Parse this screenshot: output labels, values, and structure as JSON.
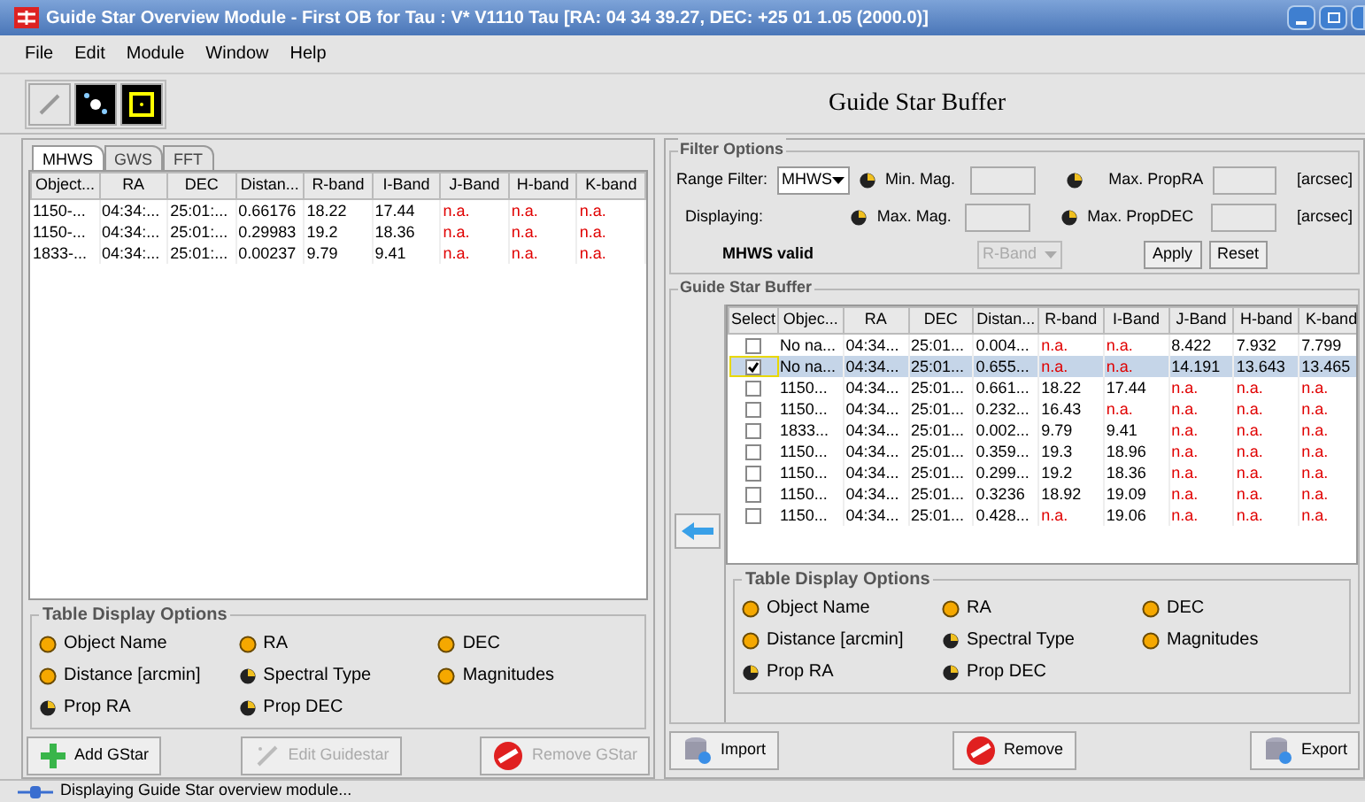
{
  "window": {
    "title": "Guide Star Overview Module - First OB for Tau : V* V1110 Tau [RA: 04 34 39.27, DEC: +25 01 1.05 (2000.0)]"
  },
  "menu": [
    "File",
    "Edit",
    "Module",
    "Window",
    "Help"
  ],
  "heading": "Guide Star Buffer",
  "left": {
    "tabs": [
      {
        "label": "MHWS",
        "selected": true
      },
      {
        "label": "GWS",
        "selected": false
      },
      {
        "label": "FFT",
        "selected": false
      }
    ],
    "columns": [
      "Object...",
      "RA",
      "DEC",
      "Distan...",
      "R-band",
      "I-Band",
      "J-Band",
      "H-band",
      "K-band"
    ],
    "rows": [
      [
        {
          "text": "1150-...",
          "unavailable": false
        },
        {
          "text": "04:34:...",
          "unavailable": false
        },
        {
          "text": "25:01:...",
          "unavailable": false
        },
        {
          "text": "0.66176",
          "unavailable": false
        },
        {
          "text": "18.22",
          "unavailable": false
        },
        {
          "text": "17.44",
          "unavailable": false
        },
        {
          "text": "n.a.",
          "unavailable": true
        },
        {
          "text": "n.a.",
          "unavailable": true
        },
        {
          "text": "n.a.",
          "unavailable": true
        }
      ],
      [
        {
          "text": "1150-...",
          "unavailable": false
        },
        {
          "text": "04:34:...",
          "unavailable": false
        },
        {
          "text": "25:01:...",
          "unavailable": false
        },
        {
          "text": "0.29983",
          "unavailable": false
        },
        {
          "text": "19.2",
          "unavailable": false
        },
        {
          "text": "18.36",
          "unavailable": false
        },
        {
          "text": "n.a.",
          "unavailable": true
        },
        {
          "text": "n.a.",
          "unavailable": true
        },
        {
          "text": "n.a.",
          "unavailable": true
        }
      ],
      [
        {
          "text": "1833-...",
          "unavailable": false
        },
        {
          "text": "04:34:...",
          "unavailable": false
        },
        {
          "text": "25:01:...",
          "unavailable": false
        },
        {
          "text": "0.00237",
          "unavailable": false
        },
        {
          "text": "9.79",
          "unavailable": false
        },
        {
          "text": "9.41",
          "unavailable": false
        },
        {
          "text": "n.a.",
          "unavailable": true
        },
        {
          "text": "n.a.",
          "unavailable": true
        },
        {
          "text": "n.a.",
          "unavailable": true
        }
      ]
    ],
    "display_options": {
      "title": "Table Display Options",
      "options": [
        {
          "label": "Object Name",
          "on": true
        },
        {
          "label": "RA",
          "on": true
        },
        {
          "label": "DEC",
          "on": true
        },
        {
          "label": "Distance [arcmin]",
          "on": true
        },
        {
          "label": "Spectral Type",
          "on": false
        },
        {
          "label": "Magnitudes",
          "on": true
        },
        {
          "label": "Prop RA",
          "on": false
        },
        {
          "label": "Prop DEC",
          "on": false
        }
      ]
    },
    "buttons": [
      {
        "label": "Add GStar",
        "kind": "add",
        "disabled": false
      },
      {
        "label": "Edit Guidestar",
        "kind": "edit",
        "disabled": true
      },
      {
        "label": "Remove GStar",
        "kind": "remove",
        "disabled": true
      }
    ]
  },
  "filter": {
    "title": "Filter Options",
    "range_label": "Range Filter:",
    "range_value": "MHWS",
    "min_mag": {
      "label": "Min. Mag.",
      "on": false
    },
    "max_prop_ra": {
      "label": "Max. PropRA",
      "on": false
    },
    "unit_1": "[arcsec]",
    "displaying_label": "Displaying:",
    "max_mag": {
      "label": "Max. Mag.",
      "on": false
    },
    "max_prop_dec": {
      "label": "Max. PropDEC",
      "on": false
    },
    "unit_2": "[arcsec]",
    "valid_label": "MHWS valid",
    "band_value": "R-Band",
    "apply": "Apply",
    "reset": "Reset"
  },
  "buffer": {
    "title": "Guide Star Buffer",
    "select_column": "Select",
    "columns": [
      "Objec...",
      "RA",
      "DEC",
      "Distan...",
      "R-band",
      "I-Band",
      "J-Band",
      "H-band",
      "K-band"
    ],
    "rows": [
      {
        "checked": false,
        "selected": false,
        "cells": [
          {
            "text": "No na...",
            "unavailable": false
          },
          {
            "text": "04:34...",
            "unavailable": false
          },
          {
            "text": "25:01...",
            "unavailable": false
          },
          {
            "text": "0.004...",
            "unavailable": false
          },
          {
            "text": "n.a.",
            "unavailable": true
          },
          {
            "text": "n.a.",
            "unavailable": true
          },
          {
            "text": "8.422",
            "unavailable": false
          },
          {
            "text": "7.932",
            "unavailable": false
          },
          {
            "text": "7.799",
            "unavailable": false
          }
        ]
      },
      {
        "checked": true,
        "selected": true,
        "cells": [
          {
            "text": "No na...",
            "unavailable": false
          },
          {
            "text": "04:34...",
            "unavailable": false
          },
          {
            "text": "25:01...",
            "unavailable": false
          },
          {
            "text": "0.655...",
            "unavailable": false
          },
          {
            "text": "n.a.",
            "unavailable": true
          },
          {
            "text": "n.a.",
            "unavailable": true
          },
          {
            "text": "14.191",
            "unavailable": false
          },
          {
            "text": "13.643",
            "unavailable": false
          },
          {
            "text": "13.465",
            "unavailable": false
          }
        ]
      },
      {
        "checked": false,
        "selected": false,
        "cells": [
          {
            "text": "1150...",
            "unavailable": false
          },
          {
            "text": "04:34...",
            "unavailable": false
          },
          {
            "text": "25:01...",
            "unavailable": false
          },
          {
            "text": "0.661...",
            "unavailable": false
          },
          {
            "text": "18.22",
            "unavailable": false
          },
          {
            "text": "17.44",
            "unavailable": false
          },
          {
            "text": "n.a.",
            "unavailable": true
          },
          {
            "text": "n.a.",
            "unavailable": true
          },
          {
            "text": "n.a.",
            "unavailable": true
          }
        ]
      },
      {
        "checked": false,
        "selected": false,
        "cells": [
          {
            "text": "1150...",
            "unavailable": false
          },
          {
            "text": "04:34...",
            "unavailable": false
          },
          {
            "text": "25:01...",
            "unavailable": false
          },
          {
            "text": "0.232...",
            "unavailable": false
          },
          {
            "text": "16.43",
            "unavailable": false
          },
          {
            "text": "n.a.",
            "unavailable": true
          },
          {
            "text": "n.a.",
            "unavailable": true
          },
          {
            "text": "n.a.",
            "unavailable": true
          },
          {
            "text": "n.a.",
            "unavailable": true
          }
        ]
      },
      {
        "checked": false,
        "selected": false,
        "cells": [
          {
            "text": "1833...",
            "unavailable": false
          },
          {
            "text": "04:34...",
            "unavailable": false
          },
          {
            "text": "25:01...",
            "unavailable": false
          },
          {
            "text": "0.002...",
            "unavailable": false
          },
          {
            "text": "9.79",
            "unavailable": false
          },
          {
            "text": "9.41",
            "unavailable": false
          },
          {
            "text": "n.a.",
            "unavailable": true
          },
          {
            "text": "n.a.",
            "unavailable": true
          },
          {
            "text": "n.a.",
            "unavailable": true
          }
        ]
      },
      {
        "checked": false,
        "selected": false,
        "cells": [
          {
            "text": "1150...",
            "unavailable": false
          },
          {
            "text": "04:34...",
            "unavailable": false
          },
          {
            "text": "25:01...",
            "unavailable": false
          },
          {
            "text": "0.359...",
            "unavailable": false
          },
          {
            "text": "19.3",
            "unavailable": false
          },
          {
            "text": "18.96",
            "unavailable": false
          },
          {
            "text": "n.a.",
            "unavailable": true
          },
          {
            "text": "n.a.",
            "unavailable": true
          },
          {
            "text": "n.a.",
            "unavailable": true
          }
        ]
      },
      {
        "checked": false,
        "selected": false,
        "cells": [
          {
            "text": "1150...",
            "unavailable": false
          },
          {
            "text": "04:34...",
            "unavailable": false
          },
          {
            "text": "25:01...",
            "unavailable": false
          },
          {
            "text": "0.299...",
            "unavailable": false
          },
          {
            "text": "19.2",
            "unavailable": false
          },
          {
            "text": "18.36",
            "unavailable": false
          },
          {
            "text": "n.a.",
            "unavailable": true
          },
          {
            "text": "n.a.",
            "unavailable": true
          },
          {
            "text": "n.a.",
            "unavailable": true
          }
        ]
      },
      {
        "checked": false,
        "selected": false,
        "cells": [
          {
            "text": "1150...",
            "unavailable": false
          },
          {
            "text": "04:34...",
            "unavailable": false
          },
          {
            "text": "25:01...",
            "unavailable": false
          },
          {
            "text": "0.3236",
            "unavailable": false
          },
          {
            "text": "18.92",
            "unavailable": false
          },
          {
            "text": "19.09",
            "unavailable": false
          },
          {
            "text": "n.a.",
            "unavailable": true
          },
          {
            "text": "n.a.",
            "unavailable": true
          },
          {
            "text": "n.a.",
            "unavailable": true
          }
        ]
      },
      {
        "checked": false,
        "selected": false,
        "cells": [
          {
            "text": "1150...",
            "unavailable": false
          },
          {
            "text": "04:34...",
            "unavailable": false
          },
          {
            "text": "25:01...",
            "unavailable": false
          },
          {
            "text": "0.428...",
            "unavailable": false
          },
          {
            "text": "n.a.",
            "unavailable": true
          },
          {
            "text": "19.06",
            "unavailable": false
          },
          {
            "text": "n.a.",
            "unavailable": true
          },
          {
            "text": "n.a.",
            "unavailable": true
          },
          {
            "text": "n.a.",
            "unavailable": true
          }
        ]
      }
    ],
    "display_options": {
      "title": "Table Display Options",
      "options": [
        {
          "label": "Object Name",
          "on": true
        },
        {
          "label": "RA",
          "on": true
        },
        {
          "label": "DEC",
          "on": true
        },
        {
          "label": "Distance [arcmin]",
          "on": true
        },
        {
          "label": "Spectral Type",
          "on": false
        },
        {
          "label": "Magnitudes",
          "on": true
        },
        {
          "label": "Prop RA",
          "on": false
        },
        {
          "label": "Prop DEC",
          "on": false
        }
      ]
    },
    "buttons": [
      {
        "label": "Import",
        "kind": "import"
      },
      {
        "label": "Remove",
        "kind": "remove"
      },
      {
        "label": "Export",
        "kind": "export"
      }
    ]
  },
  "status_bar": "Displaying Guide Star overview module..."
}
